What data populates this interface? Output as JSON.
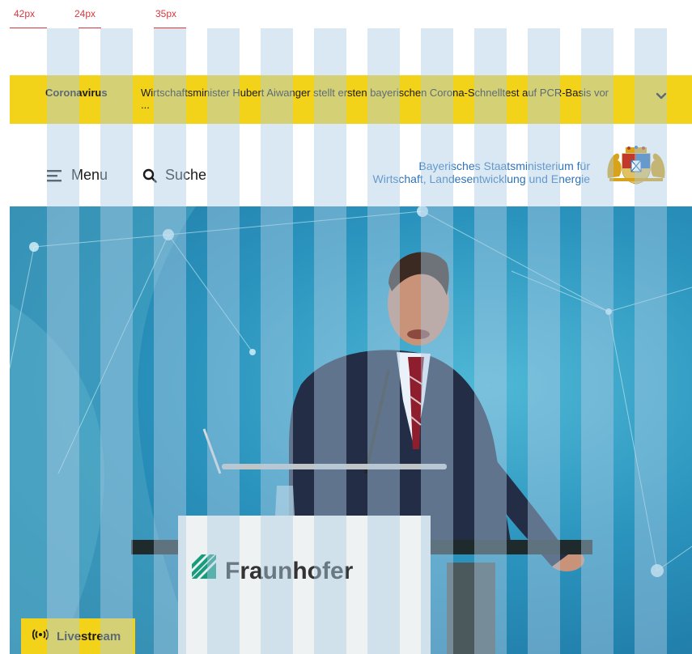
{
  "measurements": [
    "42px",
    "24px",
    "35px"
  ],
  "banner": {
    "tag": "Coronavirus",
    "text": "Wirtschaftsminister Hubert Aiwanger stellt ersten bayerischen Corona-Schnelltest auf PCR-Basis vor ..."
  },
  "header": {
    "menu_label": "Menu",
    "search_label": "Suche",
    "ministry_line1": "Bayerisches Staatsministerium für",
    "ministry_line2": "Wirtschaft, Landesentwicklung und Energie"
  },
  "hero": {
    "podium_text": "Fraunhofer",
    "livestream_label": "Livestream"
  },
  "colors": {
    "accent_yellow": "#f2d31a",
    "ministry_blue": "#2d72b8",
    "hero_blue": "#2a93bd"
  },
  "icons": {
    "menu": "menu-icon",
    "search": "search-icon",
    "chevron": "chevron-down-icon",
    "livestream": "broadcast-icon",
    "crest": "bavarian-crest-icon"
  }
}
